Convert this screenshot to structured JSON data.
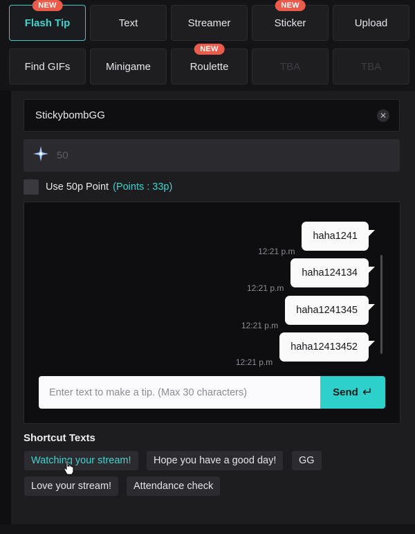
{
  "tabs": [
    {
      "label": "Flash Tip",
      "badge": "NEW"
    },
    {
      "label": "Text",
      "badge": ""
    },
    {
      "label": "Streamer",
      "badge": ""
    },
    {
      "label": "Sticker",
      "badge": "NEW"
    },
    {
      "label": "Upload",
      "badge": ""
    },
    {
      "label": "Find GIFs",
      "badge": ""
    },
    {
      "label": "Minigame",
      "badge": ""
    },
    {
      "label": "Roulette",
      "badge": "NEW"
    },
    {
      "label": "TBA",
      "badge": ""
    },
    {
      "label": "TBA",
      "badge": ""
    }
  ],
  "recipient": {
    "value": "StickybombGG",
    "clear_icon": "close-icon"
  },
  "amount": {
    "value": "50",
    "icon": "sparkle-icon"
  },
  "points": {
    "label": "Use 50p Point",
    "count": "(Points : 33p)"
  },
  "messages": [
    {
      "time": "12:21 p.m",
      "text": "haha1241"
    },
    {
      "time": "12:21 p.m",
      "text": "haha124134"
    },
    {
      "time": "12:21 p.m",
      "text": "haha1241345"
    },
    {
      "time": "12:21 p.m",
      "text": "haha12413452"
    }
  ],
  "composer": {
    "placeholder": "Enter text to make a tip. (Max 30 characters)",
    "send_label": "Send",
    "send_icon": "enter-arrow-icon"
  },
  "shortcuts": {
    "title": "Shortcut Texts",
    "items": [
      "Watching your stream!",
      "Hope you have a good day!",
      "GG",
      "Love your stream!",
      "Attendance check"
    ]
  },
  "colors": {
    "accent": "#2ed0cb",
    "badge": "#ea5b4b",
    "background": "#141416"
  }
}
